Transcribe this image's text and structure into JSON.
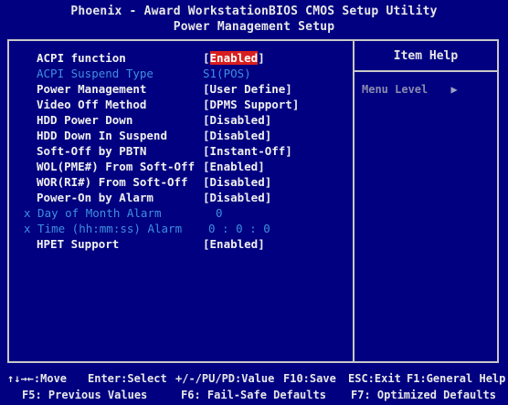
{
  "title": {
    "line1": "Phoenix - Award WorkstationBIOS CMOS Setup Utility",
    "line2": "Power Management Setup"
  },
  "menu": [
    {
      "label": "ACPI function",
      "value": "Enabled",
      "state": "selected"
    },
    {
      "label": "ACPI Suspend Type",
      "value": "S1(POS)",
      "state": "disabled"
    },
    {
      "label": "Power Management",
      "value": "[User Define]",
      "state": "normal"
    },
    {
      "label": "Video Off Method",
      "value": "[DPMS Support]",
      "state": "normal"
    },
    {
      "label": "HDD Power Down",
      "value": "[Disabled]",
      "state": "normal"
    },
    {
      "label": "HDD Down In Suspend",
      "value": "[Disabled]",
      "state": "normal"
    },
    {
      "label": "Soft-Off by PBTN",
      "value": "[Instant-Off]",
      "state": "normal"
    },
    {
      "label": "WOL(PME#) From Soft-Off",
      "value": "[Enabled]",
      "state": "normal"
    },
    {
      "label": "WOR(RI#) From Soft-Off",
      "value": "[Disabled]",
      "state": "normal"
    },
    {
      "label": "Power-On by Alarm",
      "value": "[Disabled]",
      "state": "normal"
    },
    {
      "label": "x Day of Month Alarm",
      "value": "0",
      "state": "disabled"
    },
    {
      "label": "x Time (hh:mm:ss) Alarm",
      "value": "0 : 0 : 0",
      "state": "disabled"
    },
    {
      "label": "HPET Support",
      "value": "[Enabled]",
      "state": "normal"
    }
  ],
  "help": {
    "header": "Item Help",
    "menu_level_label": "Menu Level",
    "menu_level_arrow": "▶"
  },
  "footer": {
    "nav": "↑↓→←:Move",
    "enter": "Enter:Select",
    "value": "+/-/PU/PD:Value",
    "save": "F10:Save",
    "exit": "ESC:Exit",
    "help": "F1:General Help",
    "prev": "F5: Previous Values",
    "failsafe": "F6: Fail-Safe Defaults",
    "optimized": "F7: Optimized Defaults"
  },
  "colors": {
    "background": "#000080",
    "selected_bg": "#d81e1e",
    "disabled_text": "#3f8fe0",
    "normal_text": "#f0f0f0"
  }
}
